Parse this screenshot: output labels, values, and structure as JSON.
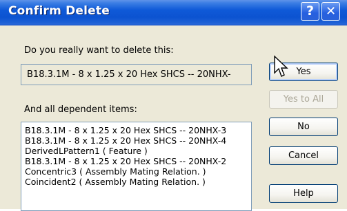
{
  "window": {
    "title": "Confirm Delete",
    "help_glyph": "?",
    "close_glyph": "✕"
  },
  "prompt": {
    "question": "Do you really want to delete this:",
    "item": "B18.3.1M - 8 x 1.25 x 20 Hex SHCS -- 20NHX-",
    "dependents_label": "And all dependent items:"
  },
  "dependents": [
    "B18.3.1M - 8 x 1.25 x 20 Hex SHCS -- 20NHX-3",
    "B18.3.1M - 8 x 1.25 x 20 Hex SHCS -- 20NHX-4",
    "DerivedLPattern1 ( Feature )",
    "B18.3.1M - 8 x 1.25 x 20 Hex SHCS -- 20NHX-2",
    "Concentric3 ( Assembly Mating Relation. )",
    "Coincident2 ( Assembly Mating Relation. )"
  ],
  "buttons": {
    "yes": "Yes",
    "yes_to_all": "Yes to All",
    "no": "No",
    "cancel": "Cancel",
    "help": "Help"
  },
  "icons": {
    "cursor": "mouse-pointer-icon"
  }
}
